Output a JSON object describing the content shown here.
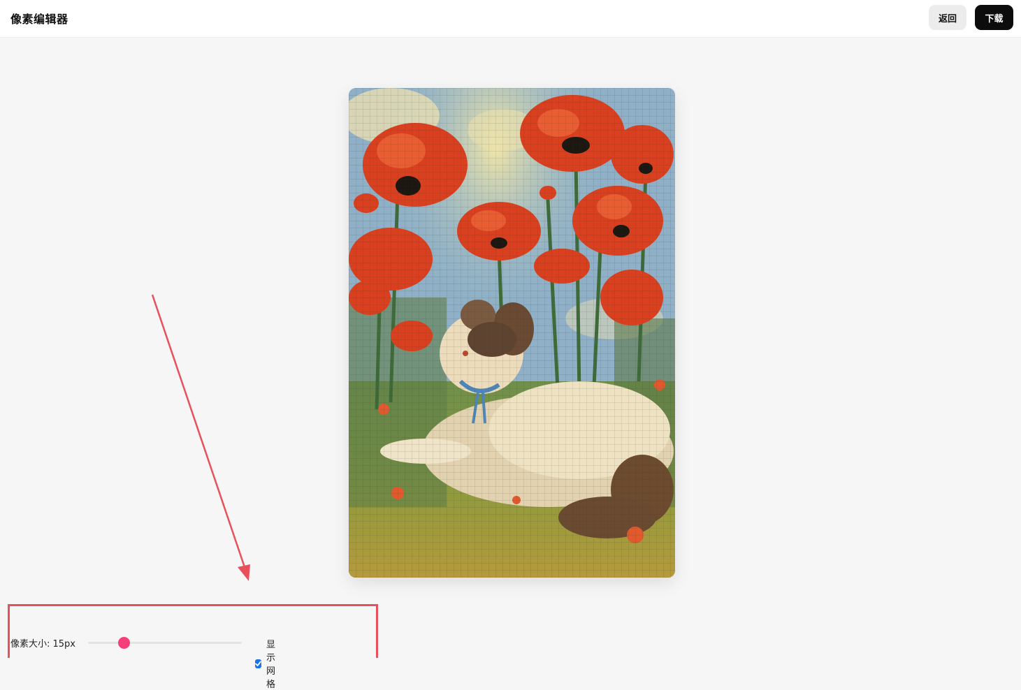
{
  "header": {
    "title": "像素编辑器",
    "back_label": "返回",
    "download_label": "下载"
  },
  "controls": {
    "pixel_size_label": "像素大小: 15px",
    "pixel_size_value": 15,
    "slider_fraction": 0.23,
    "show_grid_label": "显示网格",
    "show_grid_checked": true,
    "slider_accent_color": "#f43f7a",
    "checkbox_color": "#1a73e8"
  },
  "canvas": {
    "image_subject": "pixelated painting of a fluffy cat lying among red poppies",
    "grid_visible": true
  },
  "annotation": {
    "color": "#e8515b"
  }
}
